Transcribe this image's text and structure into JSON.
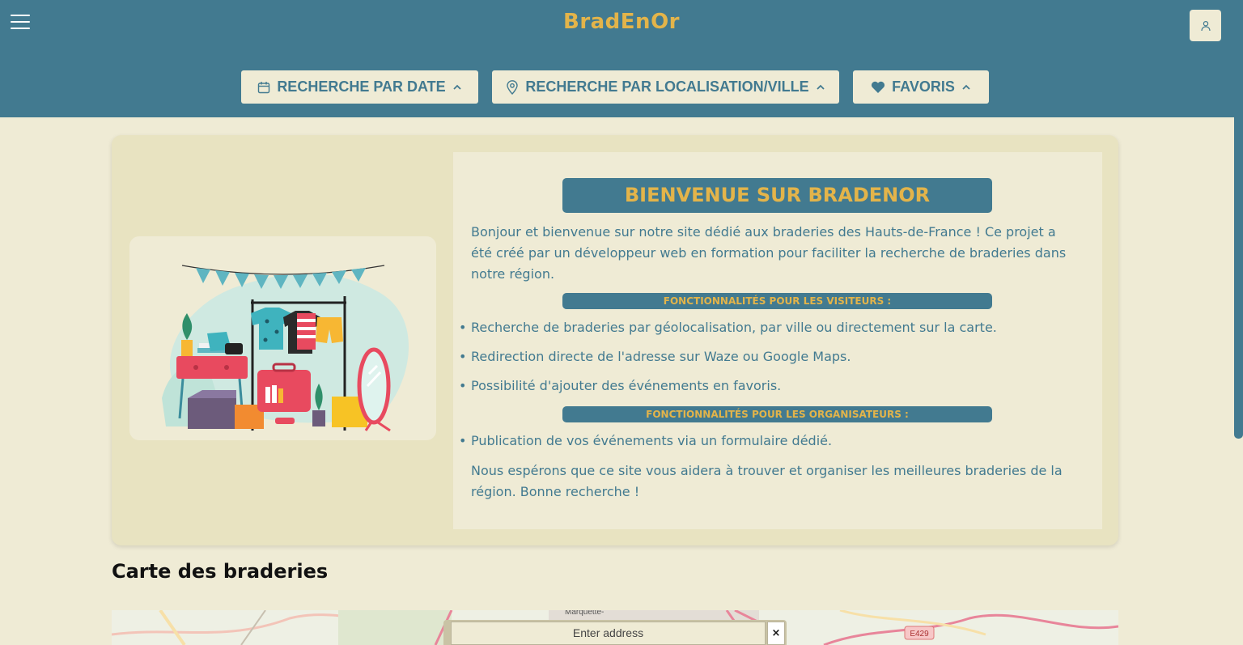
{
  "header": {
    "brand": "BradEnOr",
    "menu_icon": "hamburger-menu-icon",
    "user_icon": "user-icon"
  },
  "filters": [
    {
      "label": "RECHERCHE PAR DATE",
      "icon": "calendar-icon"
    },
    {
      "label": "RECHERCHE PAR LOCALISATION/VILLE",
      "icon": "location-pin-icon"
    },
    {
      "label": "FAVORIS",
      "icon": "heart-icon"
    }
  ],
  "welcome": {
    "title": "BIENVENUE SUR BRADENOR",
    "intro": "Bonjour et bienvenue sur notre site dédié aux braderies des Hauts-de-France ! Ce projet a été créé par un développeur web en formation pour faciliter la recherche de braderies dans notre région.",
    "visitors_title": "FONCTIONNALITÉS POUR LES VISITEURS :",
    "visitors_items": [
      "Recherche de braderies par géolocalisation, par ville ou directement sur la carte.",
      "Redirection directe de l'adresse sur Waze ou Google Maps.",
      "Possibilité d'ajouter des événements en favoris."
    ],
    "organizers_title": "FONCTIONNALITÉS POUR LES ORGANISATEURS :",
    "organizers_items": [
      "Publication de vos événements via un formulaire dédié."
    ],
    "closing": "Nous espérons que ce site vous aidera à trouver et organiser les meilleures braderies de la région. Bonne recherche !"
  },
  "map": {
    "title": "Carte des braderies",
    "address_placeholder": "Enter address",
    "close_label": "×",
    "labels": [
      "Marquette-",
      "E429"
    ]
  },
  "colors": {
    "primary": "#427a90",
    "accent": "#e3b44a",
    "background": "#efebd5",
    "card": "#e8e3c1"
  }
}
